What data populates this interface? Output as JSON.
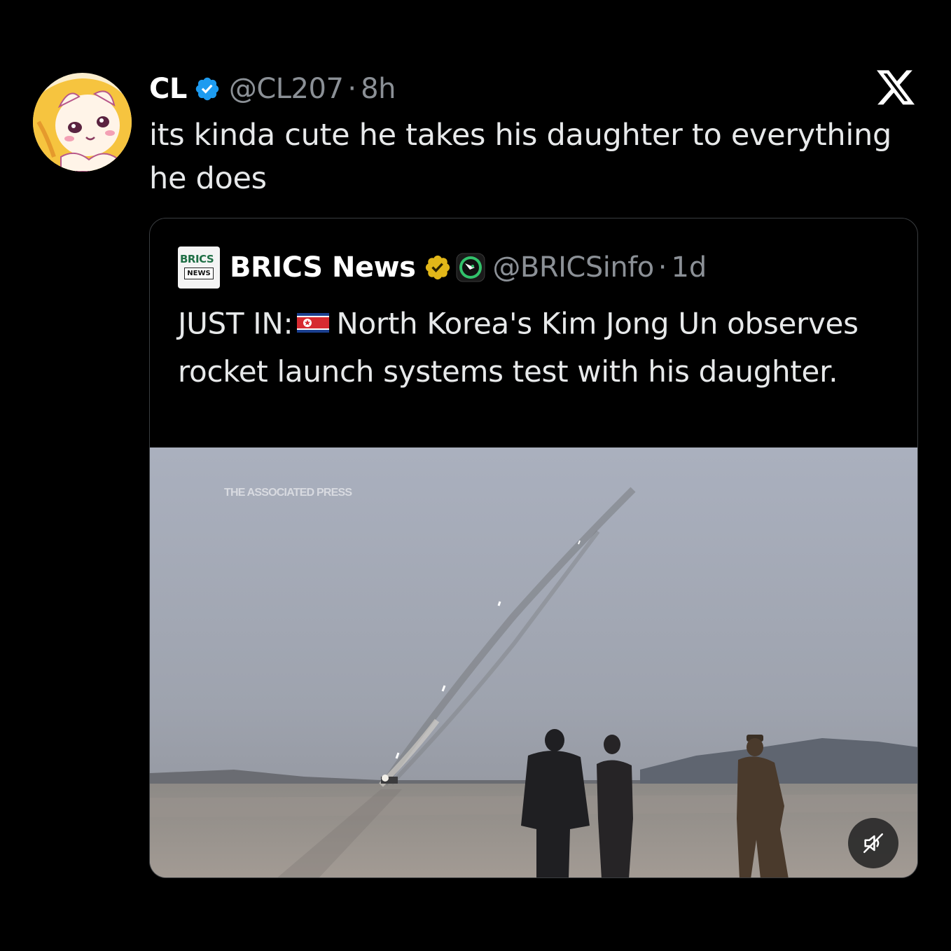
{
  "tweet": {
    "display_name": "CL",
    "verified_icon": "verified-badge-blue",
    "handle": "@CL207",
    "separator": "·",
    "time": "8h",
    "text": "its kinda cute he takes his daughter to everything he does",
    "avatar_icon": "anime-cat-avatar"
  },
  "platform_logo": "x-logo-icon",
  "quote": {
    "avatar_text_top": "BRICS",
    "avatar_text_bottom": "NEWS",
    "display_name": "BRICS News",
    "verified_icon": "verified-badge-gold",
    "affiliate_icon": "affiliate-badge-green",
    "handle": "@BRICSinfo",
    "separator": "·",
    "time": "1d",
    "text_prefix": "JUST IN:",
    "flag_icon": "north-korea-flag",
    "text_main": "North Korea's Kim Jong Un observes rocket launch systems test with his daughter.",
    "media": {
      "watermark": "THE ASSOCIATED PRESS",
      "mute_icon": "speaker-muted-icon"
    }
  },
  "colors": {
    "background": "#000000",
    "text": "#e7e9ea",
    "muted": "#8b9096",
    "verified_blue": "#1d9bf0",
    "verified_gold": "#e2b719",
    "card_border": "#3a3d40"
  }
}
